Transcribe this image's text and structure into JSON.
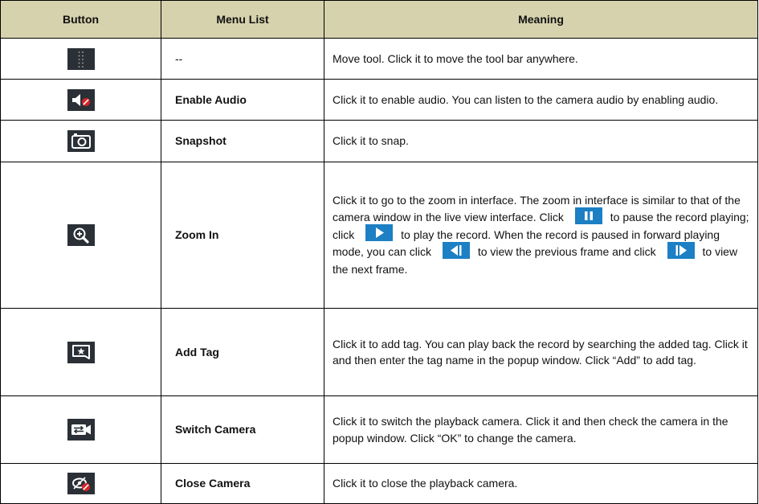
{
  "header": {
    "button": "Button",
    "menu": "Menu List",
    "meaning": "Meaning"
  },
  "rows": [
    {
      "icon": "move-tool-icon",
      "menu": "--",
      "meaning": "Move tool. Click it to move the tool bar anywhere."
    },
    {
      "icon": "audio-muted-icon",
      "menu": "Enable Audio",
      "meaning": "Click it to enable audio. You can listen to the camera audio by enabling audio."
    },
    {
      "icon": "camera-snapshot-icon",
      "menu": "Snapshot",
      "meaning": "Click it to snap."
    },
    {
      "icon": "zoom-in-icon",
      "menu": "Zoom In",
      "meaning_parts": [
        "Click it to go to the zoom in interface. The zoom in interface is similar to that of the camera window in the live view interface. Click",
        "to pause the record playing; click",
        "to play the record. When the record is paused in forward playing mode, you can click",
        "to view the previous frame and click",
        "to view the next frame."
      ]
    },
    {
      "icon": "add-tag-icon",
      "menu": "Add Tag",
      "meaning": "Click it to add tag. You can play back the record by searching the added tag. Click it and then enter the tag name in the popup window. Click “Add” to add tag."
    },
    {
      "icon": "switch-camera-icon",
      "menu": "Switch Camera",
      "meaning": "Click it to switch the playback camera. Click it and then check the camera in the popup window. Click “OK” to change the camera."
    },
    {
      "icon": "close-camera-icon",
      "menu": "Close Camera",
      "meaning": "Click it to close the playback camera."
    }
  ],
  "colors": {
    "header_bg": "#d6d2ad",
    "icon_bg": "#2a3036",
    "icon_fg": "#ffffff",
    "alert_red": "#d8232a",
    "inline_btn_bg": "#1d7fc4"
  }
}
